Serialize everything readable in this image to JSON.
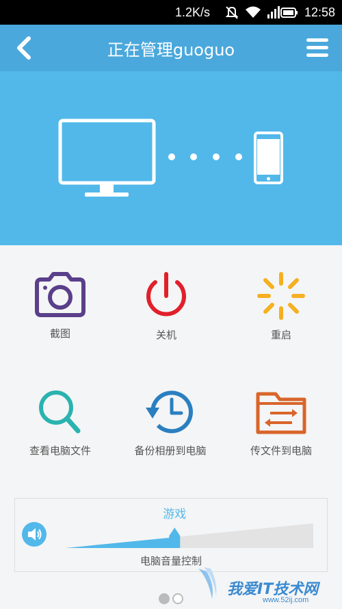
{
  "status_bar": {
    "speed": "1.2K/s",
    "clock": "12:58",
    "icons": [
      "mute-icon",
      "wifi-icon",
      "signal-icon",
      "battery-icon"
    ]
  },
  "header": {
    "title": "正在管理guoguo",
    "back_icon": "chevron-left-icon",
    "menu_icon": "hamburger-menu-icon",
    "background": "#4aa8dc"
  },
  "hero": {
    "background": "#52b8ea",
    "icons": [
      "monitor-icon",
      "connection-dots",
      "phone-icon"
    ]
  },
  "actions": [
    {
      "label": "截图",
      "icon": "camera-icon",
      "color": "#5a3f8a"
    },
    {
      "label": "关机",
      "icon": "power-icon",
      "color": "#e0202a"
    },
    {
      "label": "重启",
      "icon": "loading-spinner-icon",
      "color": "#f5b021"
    },
    {
      "label": "查看电脑文件",
      "icon": "magnifier-icon",
      "color": "#2ab3b0"
    },
    {
      "label": "备份相册到电脑",
      "icon": "history-clock-icon",
      "color": "#2a7fc0"
    },
    {
      "label": "传文件到电脑",
      "icon": "folder-transfer-icon",
      "color": "#d9652a"
    }
  ],
  "volume": {
    "mode_label": "游戏",
    "caption": "电脑音量控制",
    "level": 0.44,
    "accent": "#52b8ea"
  },
  "pagination": {
    "pages": 2,
    "current": 1
  },
  "watermark": {
    "text": "我爱IT技术网",
    "url": "www.52ij.com"
  }
}
